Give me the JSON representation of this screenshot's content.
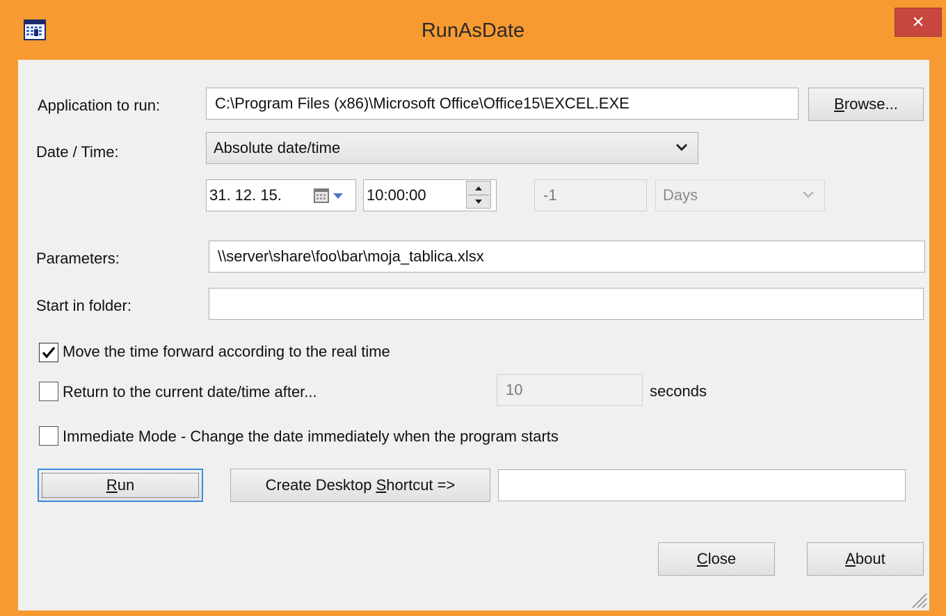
{
  "window": {
    "title": "RunAsDate",
    "close_glyph": "×",
    "accent_color": "#f79a31"
  },
  "app_row": {
    "label": "Application to run:",
    "value": "C:\\Program Files (x86)\\Microsoft Office\\Office15\\EXCEL.EXE",
    "browse_label": "Browse..."
  },
  "datetime": {
    "label": "Date / Time:",
    "mode_selected": "Absolute date/time",
    "date_value": "31. 12. 15.",
    "time_value": "10:00:00",
    "offset_value": "-1",
    "offset_unit": "Days"
  },
  "params": {
    "label": "Parameters:",
    "value": "\\\\server\\share\\foo\\bar\\moja_tablica.xlsx"
  },
  "start_folder": {
    "label": "Start in folder:",
    "value": ""
  },
  "options": {
    "move_forward": {
      "label": "Move the time forward according to the real time",
      "checked": true
    },
    "return_after": {
      "label": "Return to the current date/time after...",
      "checked": false,
      "seconds_value": "10",
      "seconds_label": "seconds"
    },
    "immediate": {
      "label": "Immediate Mode - Change the date immediately when the program starts",
      "checked": false
    }
  },
  "actions": {
    "run_label": "Run",
    "shortcut_label": "Create Desktop Shortcut =>",
    "shortcut_name": "",
    "close_label": "Close",
    "about_label": "About"
  },
  "icons": {
    "app": "calendar-icon",
    "date_picker": "calendar-dropdown-icon",
    "spin": "spin-updown-icon",
    "checkmark": "checkmark-icon",
    "grip": "resize-grip-icon"
  }
}
